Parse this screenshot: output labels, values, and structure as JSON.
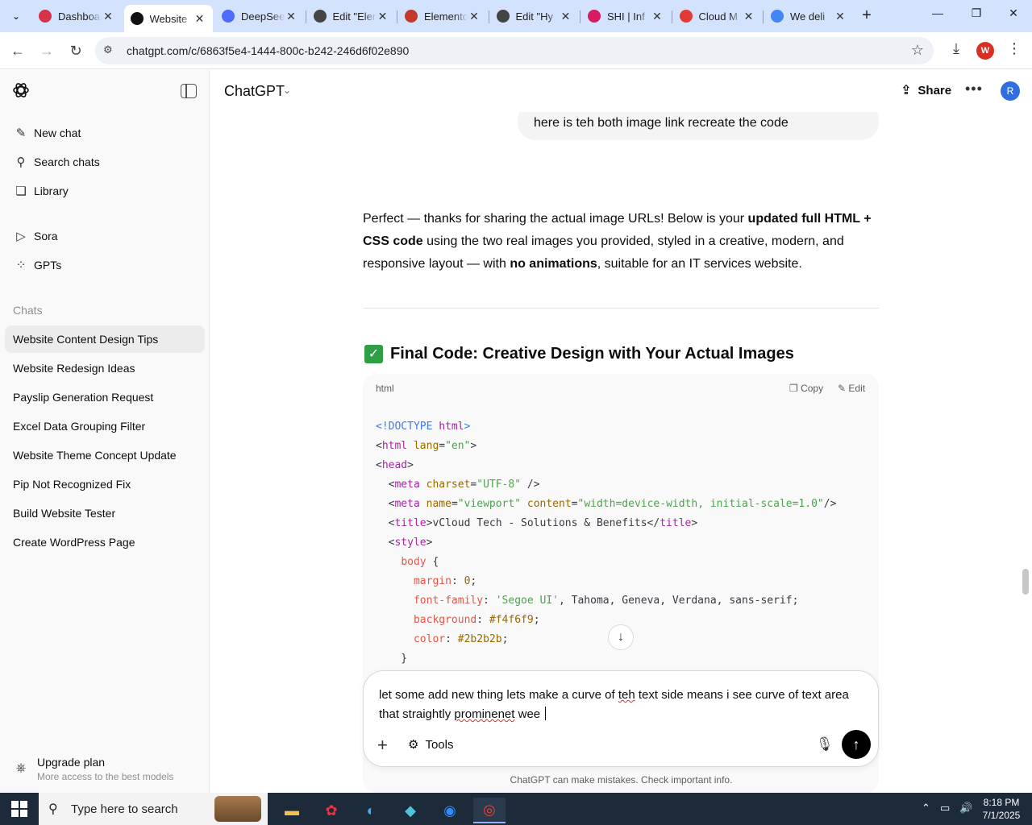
{
  "browser": {
    "tabs": [
      {
        "label": "Dashboard",
        "favicon_color": "#d6334b",
        "active": false
      },
      {
        "label": "Website",
        "favicon_color": "#111111",
        "active": true
      },
      {
        "label": "DeepSeek",
        "favicon_color": "#4d6bfe",
        "active": false
      },
      {
        "label": "Edit \"Elementor\"",
        "favicon_color": "#444444",
        "active": false
      },
      {
        "label": "Elementor",
        "favicon_color": "#c0392b",
        "active": false
      },
      {
        "label": "Edit \"Hy",
        "favicon_color": "#444444",
        "active": false
      },
      {
        "label": "SHI | Inf",
        "favicon_color": "#d81b60",
        "active": false
      },
      {
        "label": "Cloud M",
        "favicon_color": "#e53935",
        "active": false
      },
      {
        "label": "We deli",
        "favicon_color": "#4285f4",
        "active": false
      }
    ],
    "url": "chatgpt.com/c/6863f5e4-1444-800c-b242-246d6f02e890",
    "profile_initial": "W"
  },
  "sidebar": {
    "primary": [
      {
        "label": "New chat",
        "icon": "pencil-icon"
      },
      {
        "label": "Search chats",
        "icon": "search-icon"
      },
      {
        "label": "Library",
        "icon": "library-icon"
      },
      {
        "label": "Sora",
        "icon": "play-icon"
      },
      {
        "label": "GPTs",
        "icon": "grid-icon"
      }
    ],
    "chats_heading": "Chats",
    "chats": [
      "Website Content Design Tips",
      "Website Redesign Ideas",
      "Payslip Generation Request",
      "Excel Data Grouping Filter",
      "Website Theme Concept Update",
      "Pip Not Recognized Fix",
      "Build Website Tester",
      "Create WordPress Page"
    ],
    "upgrade_title": "Upgrade plan",
    "upgrade_subtitle": "More access to the best models"
  },
  "header": {
    "model": "ChatGPT",
    "share_label": "Share",
    "avatar_initial": "R"
  },
  "conversation": {
    "user_message": "here is teh both image link recreate the code",
    "answer_parts": [
      "Perfect — thanks for sharing the actual image URLs! Below is your ",
      "updated full HTML + CSS code",
      " using the two real images you provided, styled in a creative, modern, and responsive layout — with ",
      "no animations",
      ", suitable for an IT services website."
    ],
    "section_title": "Final Code: Creative Design with Your Actual Images",
    "code_lang": "html",
    "copy_label": "Copy",
    "edit_label": "Edit"
  },
  "composer": {
    "text_parts": [
      "let some add new thing lets make a curve of ",
      "teh",
      " text side means i see curve of text area that straightly ",
      "prominenet",
      " wee "
    ],
    "tools_label": "Tools"
  },
  "disclaimer": "ChatGPT can make mistakes. Check important info.",
  "taskbar": {
    "search_placeholder": "Type here to search",
    "time": "8:18 PM",
    "date": "7/1/2025"
  }
}
